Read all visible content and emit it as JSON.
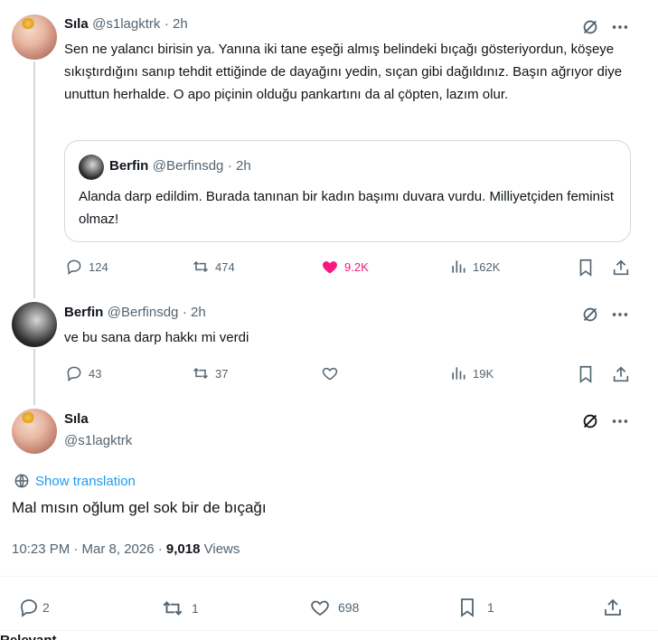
{
  "tweet1": {
    "name": "Sıla",
    "handle": "@s1lagktrk",
    "time": "· 2h",
    "text": "Sen ne yalancı birisin ya. Yanına iki tane eşeği almış belindeki bıçağı gösteriyordun, köşeye sıkıştırdığını sanıp tehdit ettiğinde de dayağını yedin, sıçan gibi dağıldınız. Başın ağrıyor diye unuttun herhalde. O apo piçinin olduğu pankartını da al çöpten, lazım olur.",
    "quote": {
      "name": "Berfin",
      "handle": "@Berfinsdg",
      "time": "· 2h",
      "text": "Alanda darp edildim. Burada tanınan bir kadın başımı duvara vurdu. Milliyetçiden feminist olmaz!"
    },
    "replies": "124",
    "retweets": "474",
    "likes": "9.2K",
    "views": "162K",
    "like_color": "#f91880"
  },
  "tweet2": {
    "name": "Berfin",
    "handle": "@Berfinsdg",
    "time": "· 2h",
    "text": "ve bu sana darp hakkı mi verdi",
    "replies": "43",
    "retweets": "37",
    "views": "19K"
  },
  "main_tweet": {
    "name": "Sıla",
    "handle": "@s1lagktrk",
    "show_translation": "Show translation",
    "text": "Mal mısın oğlum gel sok bir de bıçağı",
    "timestamp": "10:23 PM · Mar 8, 2026 ·",
    "views_count": "9,018",
    "views_label": "Views",
    "replies": "2",
    "retweets": "1",
    "likes": "698",
    "bookmarks": "1"
  },
  "section": {
    "relevant_label": "Relevant"
  },
  "colors": {
    "accent": "#1d9bf0",
    "text": "#0f1419",
    "secondary": "#536471",
    "like": "#f91880"
  }
}
